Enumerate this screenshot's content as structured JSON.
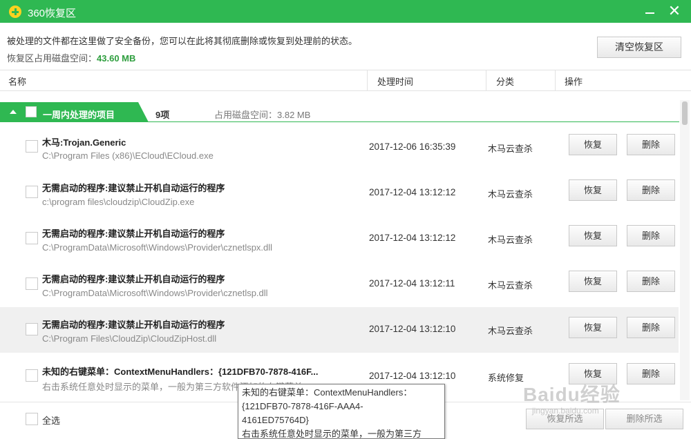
{
  "window": {
    "title": "360恢复区"
  },
  "header": {
    "info": "被处理的文件都在这里做了安全备份，您可以在此将其彻底删除或恢复到处理前的状态。",
    "usage_label": "恢复区占用磁盘空间：",
    "usage_value": "43.60 MB",
    "clear_button": "清空恢复区"
  },
  "columns": {
    "name": "名称",
    "time": "处理时间",
    "category": "分类",
    "action": "操作"
  },
  "group": {
    "title": "一周内处理的项目",
    "count": "9项",
    "usage": "占用磁盘空间：3.82 MB"
  },
  "rows": [
    {
      "name": "木马:Trojan.Generic",
      "path": "C:\\Program Files (x86)\\ECloud\\ECloud.exe",
      "time": "2017-12-06 16:35:39",
      "category": "木马云查杀",
      "restore": "恢复",
      "delete": "删除"
    },
    {
      "name": "无需启动的程序:建议禁止开机自动运行的程序",
      "path": "c:\\program files\\cloudzip\\CloudZip.exe",
      "time": "2017-12-04 13:12:12",
      "category": "木马云查杀",
      "restore": "恢复",
      "delete": "删除"
    },
    {
      "name": "无需启动的程序:建议禁止开机自动运行的程序",
      "path": "C:\\ProgramData\\Microsoft\\Windows\\Provider\\cznetlspx.dll",
      "time": "2017-12-04 13:12:12",
      "category": "木马云查杀",
      "restore": "恢复",
      "delete": "删除"
    },
    {
      "name": "无需启动的程序:建议禁止开机自动运行的程序",
      "path": "C:\\ProgramData\\Microsoft\\Windows\\Provider\\cznetlsp.dll",
      "time": "2017-12-04 13:12:11",
      "category": "木马云查杀",
      "restore": "恢复",
      "delete": "删除"
    },
    {
      "name": "无需启动的程序:建议禁止开机自动运行的程序",
      "path": "C:\\Program Files\\CloudZip\\CloudZipHost.dll",
      "time": "2017-12-04 13:12:10",
      "category": "木马云查杀",
      "restore": "恢复",
      "delete": "删除"
    },
    {
      "name": "未知的右键菜单：ContextMenuHandlers：{121DFB70-7878-416F...",
      "path": "右击系统任意处时显示的菜单，一般为第三方软件添加的右键菜单",
      "time": "2017-12-04 13:12:10",
      "category": "系统修复",
      "restore": "恢复",
      "delete": "删除"
    }
  ],
  "footer": {
    "select_all": "全选",
    "restore_selected": "恢复所选",
    "delete_selected": "删除所选"
  },
  "tooltip": {
    "line1": "未知的右键菜单：ContextMenuHandlers：",
    "line2": "{121DFB70-7878-416F-AAA4-",
    "line3": "4161ED75764D}",
    "line4": "右击系统任意处时显示的菜单，一般为第三方"
  },
  "watermark": {
    "text": "Baidu经验",
    "sub": "jingyan.baidu.com"
  }
}
